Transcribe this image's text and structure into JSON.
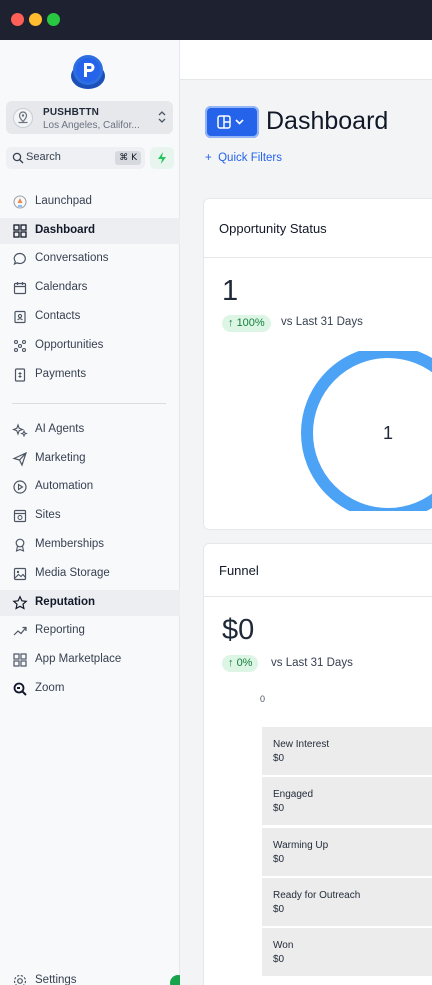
{
  "window": {
    "controls": [
      "close",
      "minimize",
      "maximize"
    ]
  },
  "account": {
    "name": "PUSHBTTN",
    "location": "Los Angeles, Califor..."
  },
  "search": {
    "label": "Search",
    "shortcut": "⌘ K"
  },
  "sidebar": {
    "items": [
      {
        "label": "Launchpad",
        "icon": "launchpad-icon"
      },
      {
        "label": "Dashboard",
        "icon": "dashboard-icon",
        "active": true
      },
      {
        "label": "Conversations",
        "icon": "chat-bubble-icon"
      },
      {
        "label": "Calendars",
        "icon": "calendar-icon"
      },
      {
        "label": "Contacts",
        "icon": "contacts-book-icon"
      },
      {
        "label": "Opportunities",
        "icon": "opportunities-icon"
      },
      {
        "label": "Payments",
        "icon": "payments-icon"
      },
      {
        "label": "AI Agents",
        "icon": "sparkle-icon"
      },
      {
        "label": "Marketing",
        "icon": "paper-plane-icon"
      },
      {
        "label": "Automation",
        "icon": "automation-icon"
      },
      {
        "label": "Sites",
        "icon": "sites-icon"
      },
      {
        "label": "Memberships",
        "icon": "award-icon"
      },
      {
        "label": "Media Storage",
        "icon": "image-icon"
      },
      {
        "label": "Reputation",
        "icon": "star-icon",
        "active": true
      },
      {
        "label": "Reporting",
        "icon": "trend-icon"
      },
      {
        "label": "App Marketplace",
        "icon": "grid-icon"
      },
      {
        "label": "Zoom",
        "icon": "zoom-icon"
      }
    ],
    "settings_label": "Settings"
  },
  "page": {
    "title": "Dashboard",
    "quick_filters": "Quick Filters"
  },
  "opportunity_status": {
    "title": "Opportunity Status",
    "value": "1",
    "change": "100%",
    "comparison": "vs Last 31 Days",
    "donut_center": "1",
    "donut_color": "#4ca3f5"
  },
  "funnel": {
    "title": "Funnel",
    "value": "$0",
    "change": "0%",
    "comparison": "vs Last 31 Days",
    "axis_zero": "0",
    "stages": [
      {
        "name": "New Interest",
        "value": "$0"
      },
      {
        "name": "Engaged",
        "value": "$0"
      },
      {
        "name": "Warming Up",
        "value": "$0"
      },
      {
        "name": "Ready for Outreach",
        "value": "$0"
      },
      {
        "name": "Won",
        "value": "$0"
      }
    ]
  },
  "colors": {
    "accent": "#2563eb",
    "positive": "#15803d",
    "positive_bg": "#dcf5e4",
    "titlebar": "#1e2230"
  }
}
